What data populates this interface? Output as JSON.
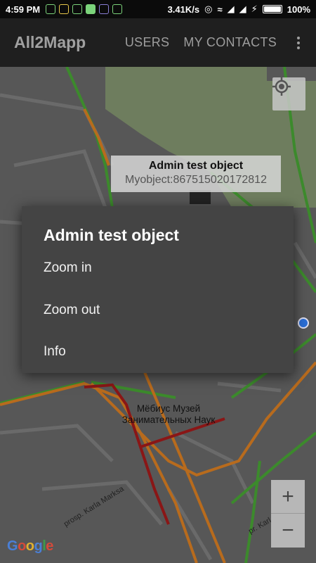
{
  "status_bar": {
    "time": "4:59 PM",
    "network_speed": "3.41K/s",
    "battery": "100%",
    "battery_level": 1.0
  },
  "app_bar": {
    "title": "All2Mapp",
    "tabs": [
      "USERS",
      "MY CONTACTS"
    ]
  },
  "map": {
    "info_window": {
      "title": "Admin test object",
      "snippet": "Myobject:867515020172812"
    },
    "poi_label": "Мёбиус Музей\nЗанимательных Наук",
    "road_label_1": "prosp. Karla Marksa",
    "road_label_2": "pr. Karl",
    "google_logo": "Google",
    "zoom_in_label": "+",
    "zoom_out_label": "−"
  },
  "dialog": {
    "title": "Admin test object",
    "items": [
      "Zoom in",
      "Zoom out",
      "Info"
    ]
  },
  "colors": {
    "dialog_bg": "#444444",
    "map_bg": "#555555",
    "park": "#6f7f5f",
    "road_orange": "#b86b1d",
    "road_red": "#8a1616",
    "road_green": "#3c8a2c"
  }
}
